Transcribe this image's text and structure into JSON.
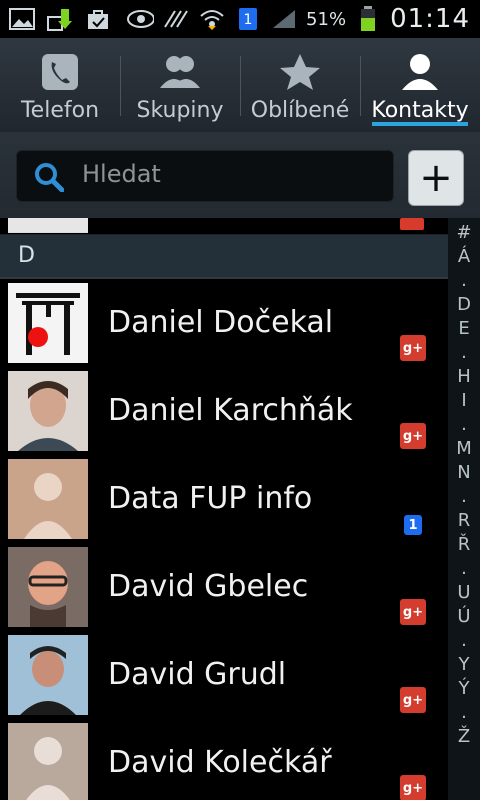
{
  "status": {
    "icons": [
      "gallery-icon",
      "download-icon",
      "bag-icon",
      "eye-icon",
      "nfc-icon",
      "wifi-icon",
      "one-icon",
      "signal-icon",
      "battery-icon"
    ],
    "battery": "51%",
    "time": "01:14"
  },
  "tabs": [
    {
      "label": "Telefon",
      "icon": "phone-icon"
    },
    {
      "label": "Skupiny",
      "icon": "people-icon"
    },
    {
      "label": "Oblíbené",
      "icon": "star-icon"
    },
    {
      "label": "Kontakty",
      "icon": "person-icon",
      "active": true
    }
  ],
  "search": {
    "placeholder": "Hledat"
  },
  "add_button": "+",
  "section": "D",
  "contacts": [
    {
      "name": "Daniel Dočekal",
      "badge": "g+",
      "avatar": "torii-icon"
    },
    {
      "name": "Daniel Karchňák",
      "badge": "g+",
      "avatar": "man-photo"
    },
    {
      "name": "Data FUP info",
      "badge": "1",
      "avatar": "default-avatar"
    },
    {
      "name": "David Gbelec",
      "badge": "g+",
      "avatar": "man-photo"
    },
    {
      "name": "David Grudl",
      "badge": "g+",
      "avatar": "man-photo"
    },
    {
      "name": "David Kolečkář",
      "badge": "g+",
      "avatar": "default-avatar"
    }
  ],
  "index_letters": [
    "#",
    "Á",
    ".",
    "D",
    "E",
    ".",
    "H",
    "I",
    ".",
    "M",
    "N",
    ".",
    "R",
    "Ř",
    ".",
    "U",
    "Ú",
    ".",
    "Y",
    "Ý",
    ".",
    "Ž"
  ],
  "colors": {
    "accent": "#2aa5e0",
    "gplus": "#d43c2d",
    "one": "#1e6cf0"
  }
}
